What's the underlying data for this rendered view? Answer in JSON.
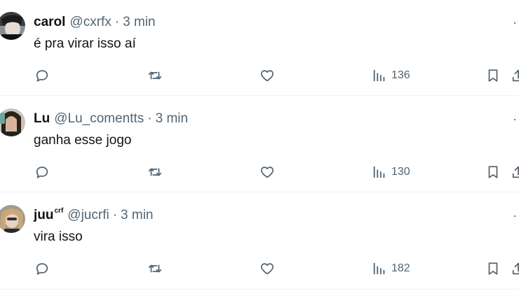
{
  "tweets": [
    {
      "name": "carol",
      "name_suffix": "",
      "handle": "@cxrfx",
      "separator": "·",
      "time": "3 min",
      "text": "é pra virar isso aí",
      "views": "136",
      "more_label": "·"
    },
    {
      "name": "Lu",
      "name_suffix": "",
      "handle": "@Lu_comentts",
      "separator": "·",
      "time": "3 min",
      "text": "ganha esse jogo",
      "views": "130",
      "more_label": "·"
    },
    {
      "name": "juu",
      "name_suffix": "crf",
      "handle": "@jucrfi",
      "separator": "·",
      "time": "3 min",
      "text": "vira isso",
      "views": "182",
      "more_label": "·"
    }
  ],
  "icons": {
    "reply": "reply-icon",
    "retweet": "retweet-icon",
    "like": "like-icon",
    "views": "views-icon",
    "bookmark": "bookmark-icon",
    "share": "share-icon"
  },
  "colors": {
    "text_primary": "#0f1419",
    "text_secondary": "#536471",
    "divider": "#eff3f4"
  }
}
